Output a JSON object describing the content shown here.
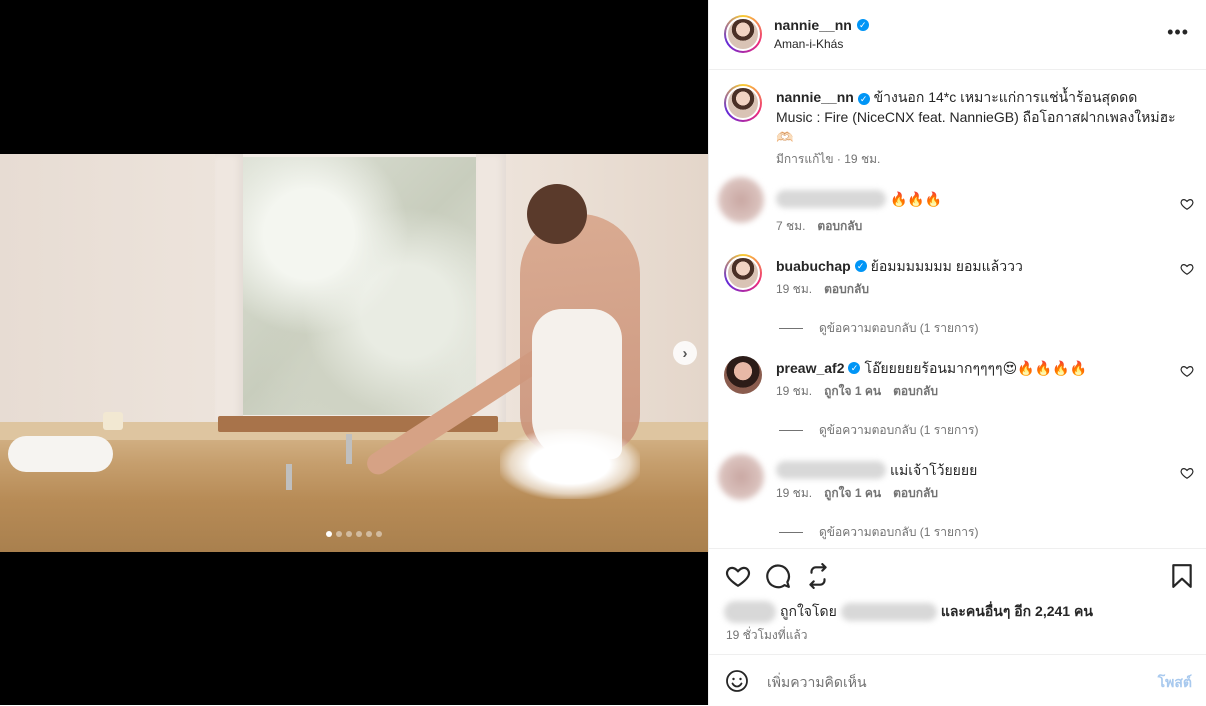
{
  "post": {
    "username": "nannie__nn",
    "location": "Aman-i-Khás",
    "caption_line1": "ข้างนอก 14*c เหมาะแก่การแช่น้ำร้อนสุดดด",
    "caption_line2": "Music : Fire (NiceCNX feat. NannieGB) ถือโอกาสฝากเพลงใหม่ฮะ",
    "caption_emoji": "🫶🏻",
    "caption_meta": "มีการแก้ไข · 19 ชม.",
    "media": {
      "slide_count": 6,
      "active_slide": 1
    }
  },
  "comments": [
    {
      "username": "",
      "text": "🔥🔥🔥",
      "time": "7 ชม.",
      "likes": "",
      "reply": "ตอบกลับ",
      "view_replies": ""
    },
    {
      "username": "buabuchap",
      "text": "ย้อมมมมมมม ยอมแล้ววว",
      "time": "19 ชม.",
      "likes": "",
      "reply": "ตอบกลับ",
      "view_replies": "ดูข้อความตอบกลับ (1 รายการ)"
    },
    {
      "username": "preaw_af2",
      "text": "โอ๊ยยยยยร้อนมากๆๆๆๆ😍🔥🔥🔥🔥",
      "time": "19 ชม.",
      "likes": "ถูกใจ 1 คน",
      "reply": "ตอบกลับ",
      "view_replies": "ดูข้อความตอบกลับ (1 รายการ)"
    },
    {
      "username": "",
      "text": "แม่เจ้าโว้ยยยย",
      "time": "19 ชม.",
      "likes": "ถูกใจ 1 คน",
      "reply": "ตอบกลับ",
      "view_replies": "ดูข้อความตอบกลับ (1 รายการ)"
    }
  ],
  "actions": {
    "liked_by_prefix": "ถูกใจโดย",
    "liked_by_suffix": "และคนอื่นๆ อีก 2,241 คน",
    "time_ago": "19 ชั่วโมงที่แล้ว"
  },
  "composer": {
    "placeholder": "เพิ่มความคิดเห็น",
    "post_label": "โพสต์"
  },
  "icons": {
    "more": "more-horizontal-icon",
    "heart": "heart-icon",
    "comment": "comment-icon",
    "share": "share-icon",
    "save": "bookmark-icon",
    "emoji": "emoji-icon",
    "next": "chevron-right-icon"
  },
  "colors": {
    "verified": "#0095f6",
    "post_button": "#a8c9ee",
    "meta": "#737373"
  }
}
